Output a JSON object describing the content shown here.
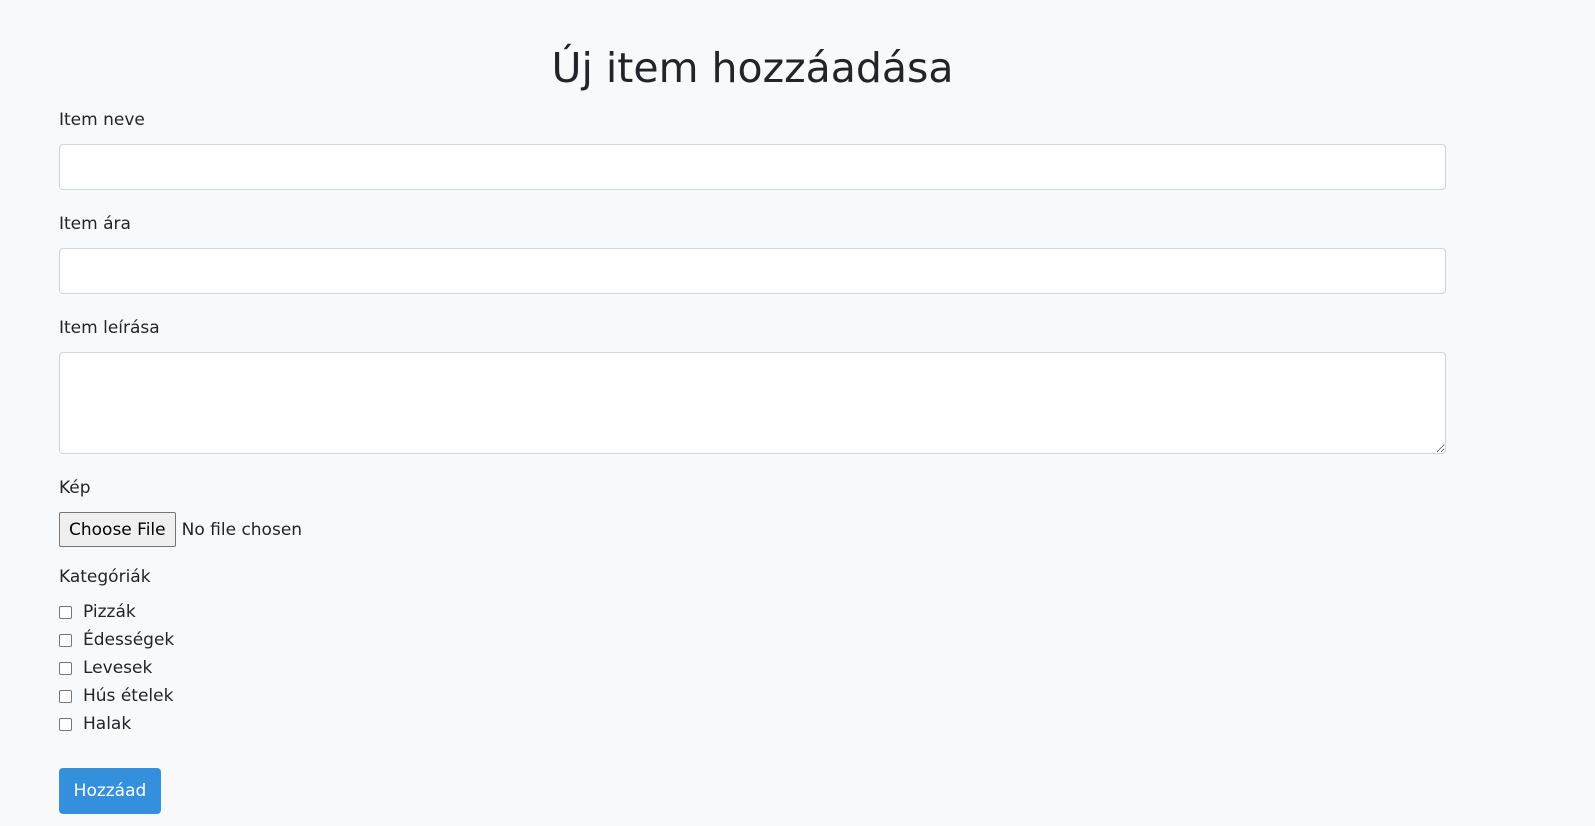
{
  "page": {
    "title": "Új item hozzáadása"
  },
  "form": {
    "name_label": "Item neve",
    "name_value": "",
    "price_label": "Item ára",
    "price_value": "",
    "description_label": "Item leírása",
    "description_value": "",
    "image_label": "Kép",
    "file_button": "Choose File",
    "file_status": "No file chosen",
    "categories_label": "Kategóriák",
    "categories": [
      {
        "label": "Pizzák",
        "checked": false
      },
      {
        "label": "Édességek",
        "checked": false
      },
      {
        "label": "Levesek",
        "checked": false
      },
      {
        "label": "Hús ételek",
        "checked": false
      },
      {
        "label": "Halak",
        "checked": false
      }
    ],
    "submit_label": "Hozzáad"
  },
  "colors": {
    "background": "#f8f9fb",
    "primary_button": "#3490dc",
    "input_border": "#ced4da"
  }
}
